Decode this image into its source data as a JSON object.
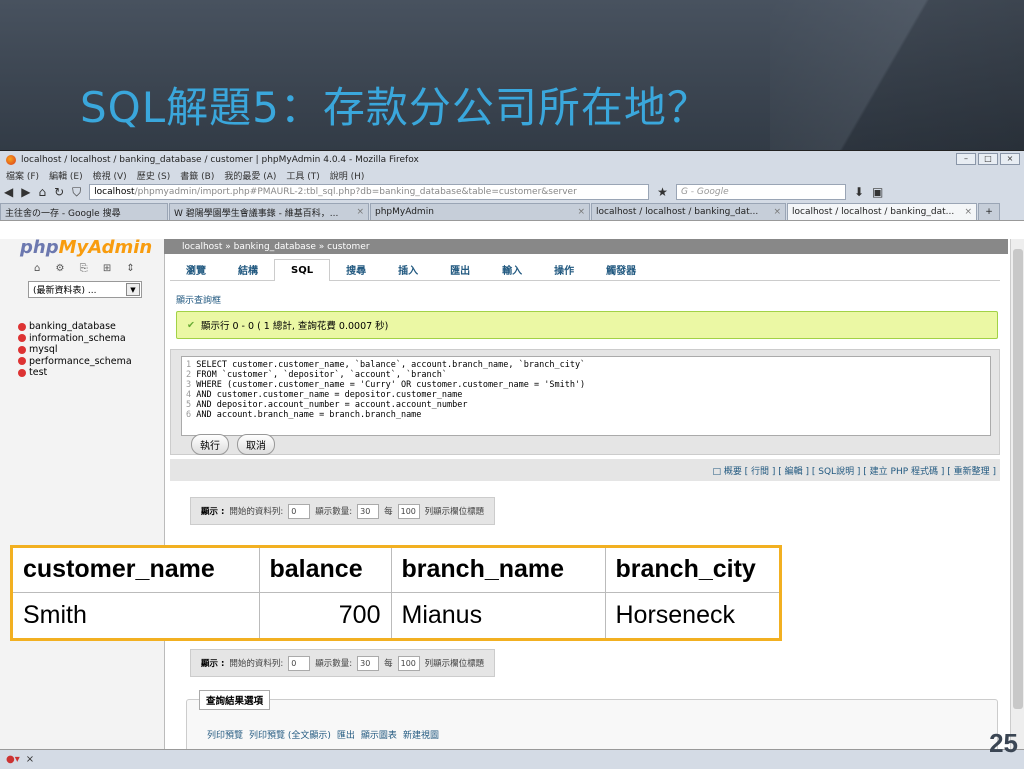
{
  "slide": {
    "title": "SQL解題5：存款分公司所在地？",
    "page_number": "25"
  },
  "window": {
    "title": "localhost / localhost / banking_database / customer | phpMyAdmin 4.0.4 - Mozilla Firefox"
  },
  "menubar": [
    "檔案 (F)",
    "編輯 (E)",
    "檢視 (V)",
    "歷史 (S)",
    "書籤 (B)",
    "我的最愛 (A)",
    "工具 (T)",
    "說明 (H)"
  ],
  "url": {
    "host": "localhost",
    "path": "/phpmyadmin/import.php#PMAURL-2:tbl_sql.php?db=banking_database&table=customer&server"
  },
  "search": {
    "placeholder": "Google"
  },
  "tabs": [
    {
      "label": "主往舍の一存 - Google 搜尋"
    },
    {
      "label": "W 碧陽學園學生會議事錄 - 維基百科，..."
    },
    {
      "label": "phpMyAdmin"
    },
    {
      "label": "localhost / localhost / banking_dat..."
    },
    {
      "label": "localhost / localhost / banking_dat..."
    }
  ],
  "sidebar": {
    "logo_php": "php",
    "logo_ma": "MyAdmin",
    "db_select": "(最新資料表) ...",
    "databases": [
      "banking_database",
      "information_schema",
      "mysql",
      "performance_schema",
      "test"
    ]
  },
  "breadcrumb": "localhost » banking_database » customer",
  "topmenu": [
    "瀏覽",
    "結構",
    "SQL",
    "搜尋",
    "插入",
    "匯出",
    "輸入",
    "操作",
    "觸發器"
  ],
  "show_query_box": "顯示查詢框",
  "success_msg": "顯示行 0 - 0 ( 1 總計, 查詢花費 0.0007 秒)",
  "sql_lines": [
    "SELECT customer.customer_name, `balance`, account.branch_name, `branch_city`",
    "FROM `customer`, `depositor`, `account`, `branch`",
    "WHERE (customer.customer_name = 'Curry' OR customer.customer_name = 'Smith')",
    "AND customer.customer_name = depositor.customer_name",
    "AND depositor.account_number = account.account_number",
    "AND account.branch_name = branch.branch_name"
  ],
  "buttons": {
    "execute": "執行",
    "cancel": "取消"
  },
  "links_bar": "□ 概要 [ 行間 ] [ 編輯 ] [ SQL說明 ] [ 建立 PHP 程式碼 ] [ 重新整理 ]",
  "nav": {
    "show": "顯示 :",
    "start_label": "開始的資料列:",
    "start": "0",
    "count_label": "顯示數量:",
    "count": "30",
    "per": "每",
    "per_val": "100",
    "repeat": "列顯示欄位標題"
  },
  "result": {
    "headers": [
      "customer_name",
      "balance",
      "branch_name",
      "branch_city"
    ],
    "row": [
      "Smith",
      "700",
      "Mianus",
      "Horseneck"
    ]
  },
  "query_options": {
    "legend": "查詢結果選項",
    "links": [
      "列印預覽",
      "列印預覽 (全文顯示)",
      "匯出",
      "顯示圖表",
      "新建視圖"
    ]
  },
  "status": "×"
}
